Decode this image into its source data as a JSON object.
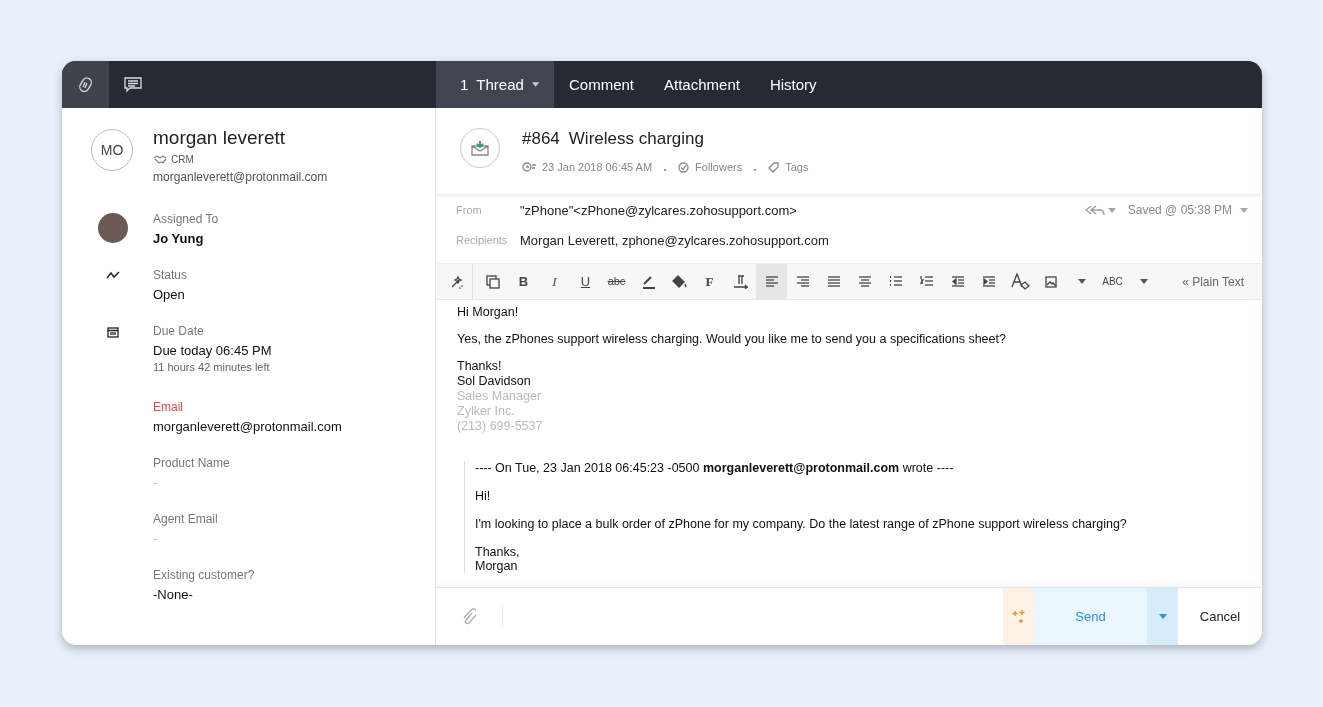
{
  "side_tabs": [
    {
      "kind": "clip",
      "selected": true
    },
    {
      "kind": "chat",
      "selected": false
    }
  ],
  "tabs": [
    {
      "count": "1",
      "label": "Thread",
      "selected": true,
      "dropdown": true
    },
    {
      "label": "Comment",
      "selected": false,
      "dropdown": false
    },
    {
      "label": "Attachment",
      "selected": false,
      "dropdown": false
    },
    {
      "label": "History",
      "selected": false,
      "dropdown": false
    }
  ],
  "contact": {
    "initials": "MO",
    "name": "morgan leverett",
    "source": "CRM",
    "email": "morganleverett@protonmail.com"
  },
  "fields": [
    {
      "kind": "avatar",
      "label": "Assigned To",
      "value": "Jo Yung",
      "bold": true,
      "required": false,
      "muted": false
    },
    {
      "kind": "status",
      "label": "Status",
      "value": "Open",
      "bold": false,
      "required": false,
      "muted": false
    },
    {
      "kind": "date",
      "label": "Due Date",
      "value": "Due today 06:45 PM",
      "note": "11 hours 42 minutes left",
      "bold": false,
      "required": false,
      "muted": false
    },
    {
      "kind": "plain",
      "label": "Email",
      "value": "morganleverett@protonmail.com",
      "bold": false,
      "required": true,
      "muted": false
    },
    {
      "kind": "plain",
      "label": "Product Name",
      "value": "-",
      "bold": false,
      "required": false,
      "muted": true
    },
    {
      "kind": "plain",
      "label": "Agent Email",
      "value": "-",
      "bold": false,
      "required": false,
      "muted": true
    },
    {
      "kind": "plain",
      "label": "Existing customer?",
      "value": "-None-",
      "bold": false,
      "required": false,
      "muted": false
    }
  ],
  "ticket": {
    "number": "#864",
    "title": "Wireless charging",
    "date": "23 Jan 2018 06:45 AM",
    "followers": "Followers",
    "tags": "Tags"
  },
  "composer": {
    "from_label": "From",
    "from": "\"zPhone\"<zPhone@zylcares.zohosupport.com>",
    "recipients_label": "Recipients",
    "recipients": "Morgan Leverett, zphone@zylcares.zohosupport.com",
    "saved": "Saved @ 05:38 PM"
  },
  "toolbar": [
    {
      "kind": "magic",
      "selected": false
    },
    {
      "kind": "copy",
      "selected": false
    },
    {
      "kind": "bold",
      "glyph": "B",
      "selected": false
    },
    {
      "kind": "italic",
      "glyph": "I",
      "selected": false
    },
    {
      "kind": "underline",
      "glyph": "U",
      "selected": false
    },
    {
      "kind": "strike",
      "glyph": "abc",
      "selected": false
    },
    {
      "kind": "font-color",
      "selected": false
    },
    {
      "kind": "fill",
      "selected": false
    },
    {
      "kind": "font",
      "glyph": "F",
      "selected": false
    },
    {
      "kind": "direction",
      "selected": false
    },
    {
      "kind": "align-left",
      "selected": true
    },
    {
      "kind": "align-right",
      "selected": false
    },
    {
      "kind": "justify",
      "selected": false
    },
    {
      "kind": "align-center",
      "selected": false
    },
    {
      "kind": "bullets",
      "selected": false
    },
    {
      "kind": "numbers",
      "selected": false
    },
    {
      "kind": "outdent",
      "selected": false
    },
    {
      "kind": "indent",
      "selected": false
    },
    {
      "kind": "clear",
      "selected": false
    },
    {
      "kind": "image",
      "selected": false
    },
    {
      "kind": "caret",
      "selected": false
    },
    {
      "kind": "spell",
      "glyph": "ABC",
      "selected": false
    },
    {
      "kind": "caret",
      "selected": false
    }
  ],
  "plain_text": "« Plain Text",
  "reply": {
    "greeting": "Hi Morgan!",
    "message": "Yes, the zPhones support wireless charging. Would you like me to send you a specifications sheet?",
    "signature": [
      {
        "text": "Thanks!",
        "muted": false
      },
      {
        "text": "Sol Davidson",
        "muted": false
      },
      {
        "text": "Sales Manager",
        "muted": true
      },
      {
        "text": "Zylker Inc.",
        "muted": true
      },
      {
        "text": "(213) 699-5537",
        "muted": true
      }
    ]
  },
  "quote": {
    "header": "---- On Tue, 23 Jan 2018 06:45:23 -0500 **morganleverett@protonmail.com**  wrote ----",
    "greeting": "Hi!",
    "message": "I'm looking to place a bulk order of zPhone for my company. Do the latest range of zPhone support wireless charging?",
    "closing": [
      "Thanks,",
      "Morgan"
    ]
  },
  "footer": {
    "send": "Send",
    "cancel": "Cancel"
  }
}
